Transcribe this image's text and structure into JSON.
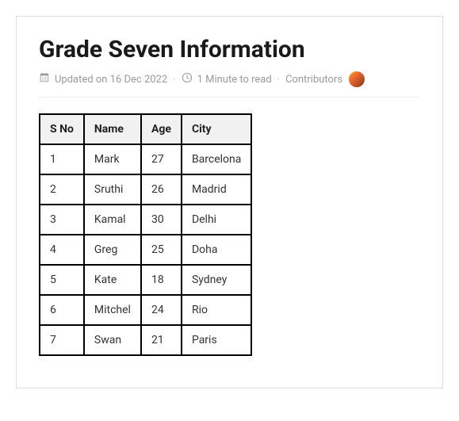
{
  "title": "Grade Seven Information",
  "meta": {
    "updated": "Updated on 16 Dec 2022",
    "read_time": "1 Minute to read",
    "contributors_label": "Contributors"
  },
  "table": {
    "headers": [
      "S No",
      "Name",
      "Age",
      "City"
    ],
    "rows": [
      [
        "1",
        "Mark",
        "27",
        "Barcelona"
      ],
      [
        "2",
        "Sruthi",
        "26",
        "Madrid"
      ],
      [
        "3",
        "Kamal",
        "30",
        "Delhi"
      ],
      [
        "4",
        "Greg",
        "25",
        "Doha"
      ],
      [
        "5",
        "Kate",
        "18",
        "Sydney"
      ],
      [
        "6",
        "Mitchel",
        "24",
        "Rio"
      ],
      [
        "7",
        "Swan",
        "21",
        "Paris"
      ]
    ]
  },
  "chart_data": {
    "type": "table",
    "title": "Grade Seven Information",
    "columns": [
      "S No",
      "Name",
      "Age",
      "City"
    ],
    "data": [
      {
        "S No": 1,
        "Name": "Mark",
        "Age": 27,
        "City": "Barcelona"
      },
      {
        "S No": 2,
        "Name": "Sruthi",
        "Age": 26,
        "City": "Madrid"
      },
      {
        "S No": 3,
        "Name": "Kamal",
        "Age": 30,
        "City": "Delhi"
      },
      {
        "S No": 4,
        "Name": "Greg",
        "Age": 25,
        "City": "Doha"
      },
      {
        "S No": 5,
        "Name": "Kate",
        "Age": 18,
        "City": "Sydney"
      },
      {
        "S No": 6,
        "Name": "Mitchel",
        "Age": 24,
        "City": "Rio"
      },
      {
        "S No": 7,
        "Name": "Swan",
        "Age": 21,
        "City": "Paris"
      }
    ]
  }
}
